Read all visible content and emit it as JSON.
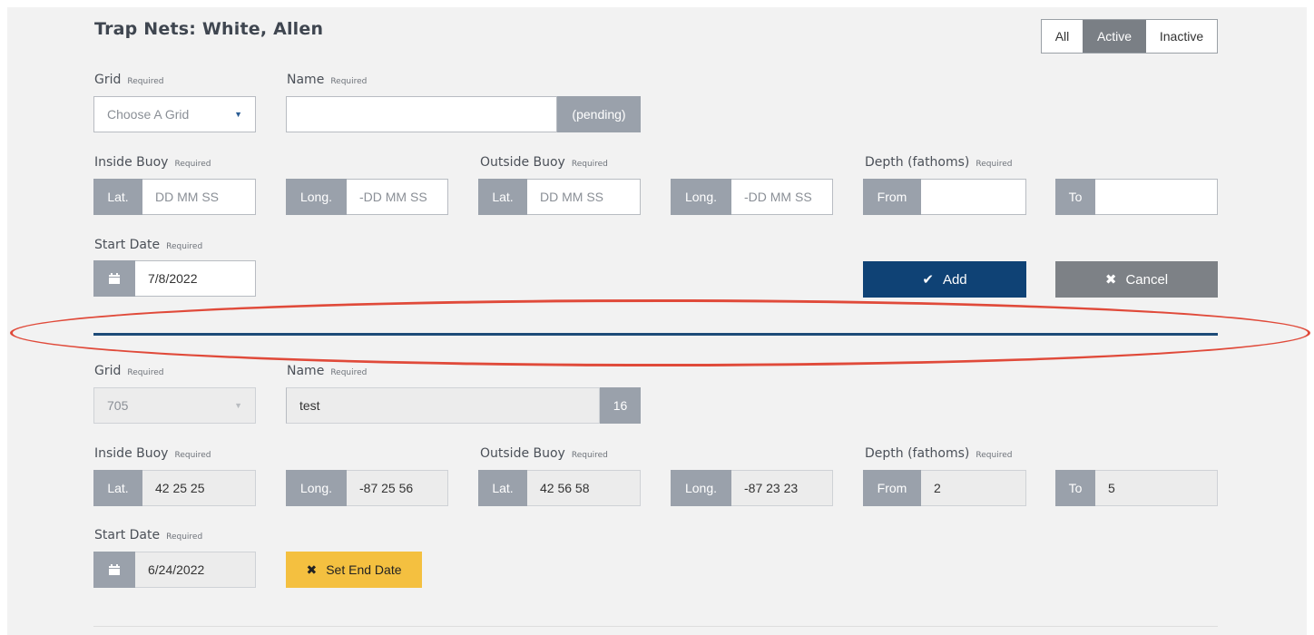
{
  "page": {
    "title": "Trap Nets: White, Allen"
  },
  "filter": {
    "all": "All",
    "active": "Active",
    "inactive": "Inactive",
    "selected": "Active"
  },
  "labels": {
    "grid": "Grid",
    "name": "Name",
    "inside_buoy": "Inside Buoy",
    "outside_buoy": "Outside Buoy",
    "depth": "Depth (fathoms)",
    "start_date": "Start Date",
    "required": "Required",
    "lat": "Lat.",
    "long": "Long.",
    "from": "From",
    "to": "To"
  },
  "new_form": {
    "grid_placeholder": "Choose A Grid",
    "name_value": "",
    "name_badge": "(pending)",
    "inside_lat_placeholder": "DD MM SS",
    "inside_long_placeholder": "-DD MM SS",
    "outside_lat_placeholder": "DD MM SS",
    "outside_long_placeholder": "-DD MM SS",
    "depth_from": "",
    "depth_to": "",
    "start_date": "7/8/2022",
    "add_label": "Add",
    "cancel_label": "Cancel"
  },
  "existing_net": {
    "grid": "705",
    "name": "test",
    "name_badge": "16",
    "inside_lat": "42 25 25",
    "inside_long": "-87 25 56",
    "outside_lat": "42 56 58",
    "outside_long": "-87 23 23",
    "depth_from": "2",
    "depth_to": "5",
    "start_date": "6/24/2022",
    "set_end_date_label": "Set End Date"
  },
  "colors": {
    "primary": "#0f4275",
    "warning": "#f4c040",
    "addon": "#9aa1ab",
    "highlight_ellipse": "#e04a3a"
  },
  "icons": {
    "add": "check-icon",
    "cancel": "x-icon",
    "calendar": "calendar-icon",
    "end": "x-icon",
    "dropdown": "caret-down-icon"
  }
}
